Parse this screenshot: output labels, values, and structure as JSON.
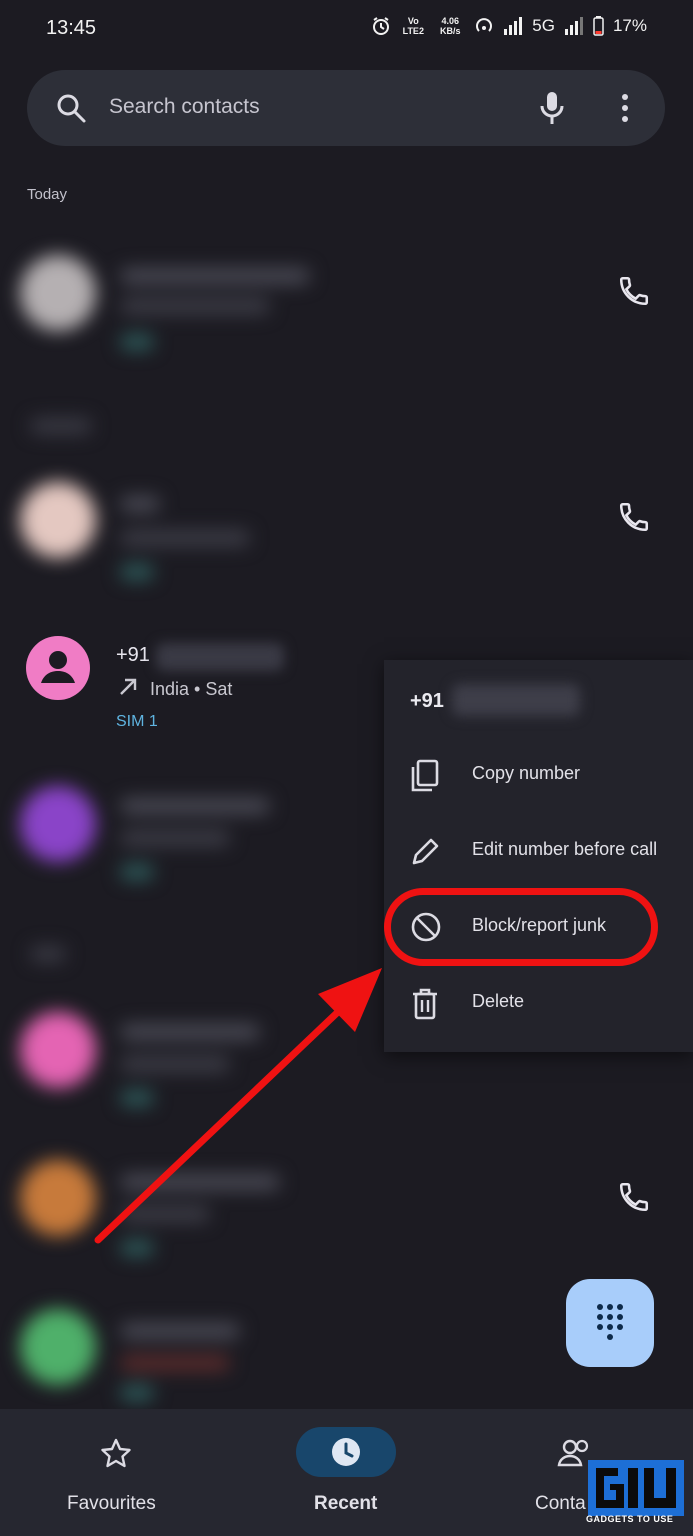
{
  "status_bar": {
    "time": "13:45",
    "volte_label": "Vo LTE2",
    "net_speed": "4.06 KB/s",
    "network": "5G",
    "battery": "17%"
  },
  "search": {
    "placeholder": "Search contacts",
    "icons": [
      "search-icon",
      "mic-icon",
      "more-vert-icon"
    ]
  },
  "call_log": {
    "section_label": "Today",
    "contact": {
      "number_prefix": "+91",
      "direction_icon": "outgoing-call-arrow-icon",
      "meta": "India • Sat",
      "sim": "SIM 1",
      "avatar_color": "#f07cc5"
    }
  },
  "context_menu": {
    "header_prefix": "+91",
    "items": [
      {
        "label": "Copy number",
        "icon": "copy-icon"
      },
      {
        "label": "Edit number before call",
        "icon": "pencil-icon"
      },
      {
        "label": "Block/report junk",
        "icon": "block-icon"
      },
      {
        "label": "Delete",
        "icon": "trash-icon"
      }
    ],
    "highlight_color": "#ef1212"
  },
  "fab": {
    "icon": "dialpad-icon",
    "color": "#a8cdfa"
  },
  "bottom_nav": {
    "items": [
      {
        "label": "Favourites",
        "icon": "star-icon",
        "active": false
      },
      {
        "label": "Recent",
        "icon": "clock-icon",
        "active": true
      },
      {
        "label": "Conta",
        "icon": "contacts-icon",
        "active": false
      }
    ],
    "active_pill_color": "#18466b"
  },
  "watermark": {
    "text": "GADGETS TO USE"
  },
  "colors": {
    "background": "#1c1b22",
    "surface": "#2d2f38",
    "accent_blue": "#5fb4e0",
    "annotation_red": "#ef1212"
  }
}
